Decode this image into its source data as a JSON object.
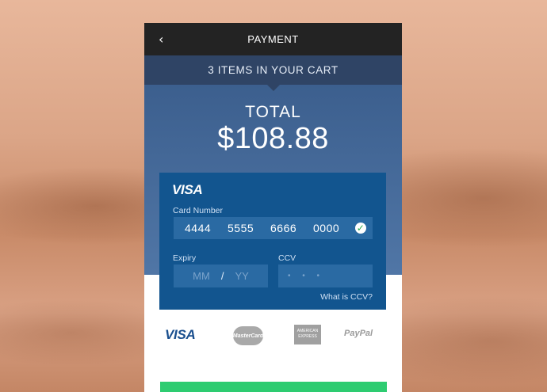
{
  "header": {
    "back_icon": "‹",
    "title": "PAYMENT"
  },
  "cart": {
    "summary": "3 ITEMS IN YOUR CART"
  },
  "total": {
    "label": "TOTAL",
    "amount": "$108.88"
  },
  "card": {
    "brand": "VISA",
    "number_label": "Card Number",
    "number_groups": [
      "4444",
      "5555",
      "6666",
      "0000"
    ],
    "valid_icon": "check-circle-icon",
    "expiry_label": "Expiry",
    "expiry_mm_placeholder": "MM",
    "expiry_separator": "/",
    "expiry_yy_placeholder": "YY",
    "ccv_label": "CCV",
    "ccv_placeholder": "• • •",
    "ccv_help": "What is CCV?"
  },
  "payment_methods": {
    "visa": "VISA",
    "mastercard": "MasterCard",
    "amex": "AMERICAN EXPRESS",
    "paypal": "PayPal"
  },
  "colors": {
    "topbar": "#232323",
    "cartbar": "#2f4465",
    "card": "#12558f",
    "pay_button": "#2ecc71"
  }
}
